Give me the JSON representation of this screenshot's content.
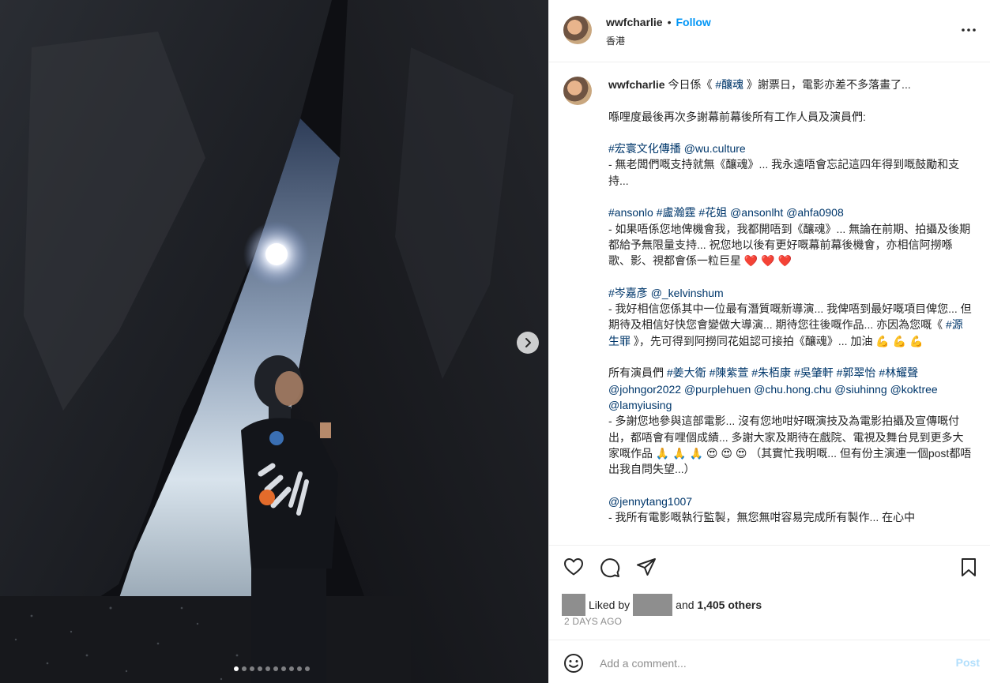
{
  "photo": {
    "alt_icon": "chevron-right-icon",
    "carousel_count": 10,
    "carousel_active": 0
  },
  "header": {
    "username": "wwfcharlie",
    "separator": "•",
    "follow_label": "Follow",
    "location": "香港",
    "more_icon": "more-horizontal-icon"
  },
  "caption": {
    "username": "wwfcharlie",
    "segments": [
      {
        "t": " 今日係《 "
      },
      {
        "t": "#釀魂",
        "tag": true
      },
      {
        "t": " 》謝票日，電影亦差不多落畫了...\n\n喺哩度最後再次多謝幕前幕後所有工作人員及演員們:\n\n"
      },
      {
        "t": "#宏寰文化傳播",
        "tag": true
      },
      {
        "t": " "
      },
      {
        "t": "@wu.culture",
        "tag": true
      },
      {
        "t": "\n- 無老闆們嘅支持就無《釀魂》... 我永遠唔會忘記這四年得到嘅鼓勵和支持...\n\n"
      },
      {
        "t": "#ansonlo",
        "tag": true
      },
      {
        "t": " "
      },
      {
        "t": "#盧瀚霆",
        "tag": true
      },
      {
        "t": " "
      },
      {
        "t": "#花姐",
        "tag": true
      },
      {
        "t": " "
      },
      {
        "t": "@ansonlht",
        "tag": true
      },
      {
        "t": " "
      },
      {
        "t": "@ahfa0908",
        "tag": true
      },
      {
        "t": "\n- 如果唔係您地俾機會我，我都開唔到《釀魂》... 無論在前期、拍攝及後期都給予無限量支持... 祝您地以後有更好嘅幕前幕後機會，亦相信阿撈喺歌、影、視都會係一粒巨星 ❤️ ❤️ ❤️\n\n"
      },
      {
        "t": "#岑嘉彥",
        "tag": true
      },
      {
        "t": " "
      },
      {
        "t": "@_kelvinshum",
        "tag": true
      },
      {
        "t": "\n- 我好相信您係其中一位最有潛質嘅新導演... 我俾唔到最好嘅項目俾您... 但期待及相信好快您會變做大導演... 期待您往後嘅作品... 亦因為您嘅《 "
      },
      {
        "t": "#源生罪",
        "tag": true
      },
      {
        "t": " 》，先可得到阿撈同花姐認可接拍《釀魂》... 加油 💪 💪 💪\n\n所有演員們 "
      },
      {
        "t": "#姜大衛",
        "tag": true
      },
      {
        "t": " "
      },
      {
        "t": "#陳紫萱",
        "tag": true
      },
      {
        "t": " "
      },
      {
        "t": "#朱栢康",
        "tag": true
      },
      {
        "t": " "
      },
      {
        "t": "#吳肇軒",
        "tag": true
      },
      {
        "t": " "
      },
      {
        "t": "#郭翠怡",
        "tag": true
      },
      {
        "t": " "
      },
      {
        "t": "#林耀聲",
        "tag": true
      },
      {
        "t": " "
      },
      {
        "t": "@johngor2022",
        "tag": true
      },
      {
        "t": " "
      },
      {
        "t": "@purplehuen",
        "tag": true
      },
      {
        "t": " "
      },
      {
        "t": "@chu.hong.chu",
        "tag": true
      },
      {
        "t": " "
      },
      {
        "t": "@siuhinng",
        "tag": true
      },
      {
        "t": " "
      },
      {
        "t": "@koktree",
        "tag": true
      },
      {
        "t": " "
      },
      {
        "t": "@lamyiusing",
        "tag": true
      },
      {
        "t": "\n- 多謝您地參與這部電影... 沒有您地咁好嘅演技及為電影拍攝及宣傳嘅付出，都唔會有哩個成績... 多謝大家及期待在戲院、電視及舞台見到更多大家嘅作品 🙏 🙏 🙏 😍 😍 😍 （其實忙我明嘅... 但有份主演連一個post都唔出我自問失望...）\n\n"
      },
      {
        "t": "@jennytang1007",
        "tag": true
      },
      {
        "t": "\n- 我所有電影嘅執行監製，無您無咁容易完成所有製作... 在心中"
      }
    ]
  },
  "actions": {
    "like_icon": "heart-icon",
    "comment_icon": "comment-icon",
    "share_icon": "share-icon",
    "save_icon": "bookmark-icon"
  },
  "likes": {
    "prefix": "Liked by",
    "middle": "and",
    "count_text": "1,405 others"
  },
  "date": "2 DAYS AGO",
  "comment": {
    "emoji_icon": "smiley-icon",
    "placeholder": "Add a comment...",
    "post_label": "Post"
  }
}
